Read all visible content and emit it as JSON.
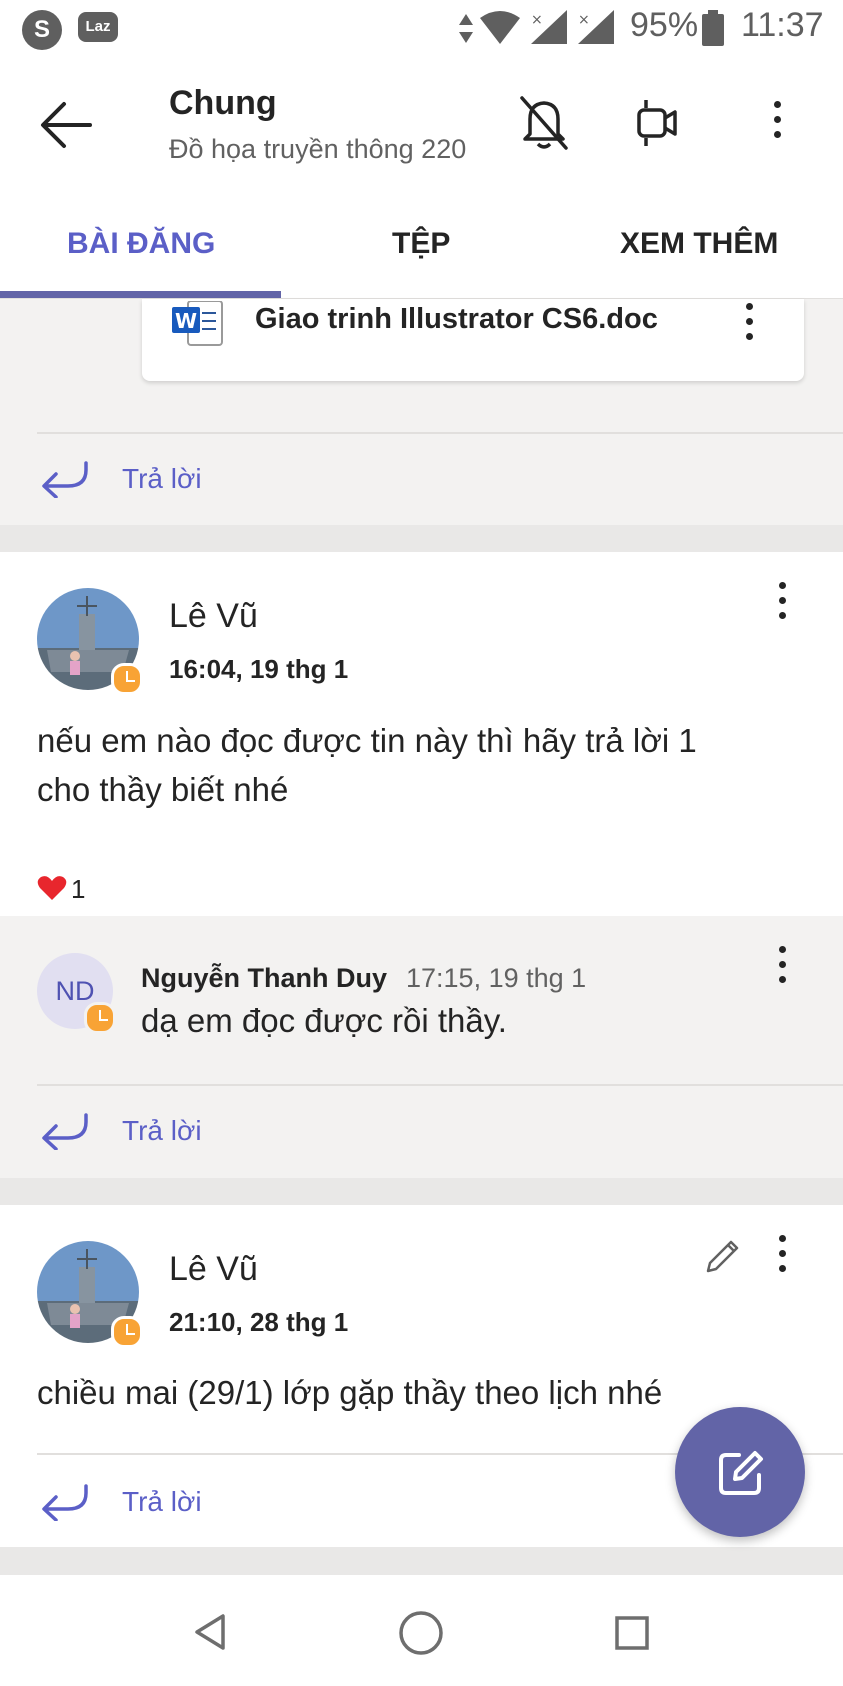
{
  "status_bar": {
    "left_icons": [
      "s-app-icon",
      "lazada-icon"
    ],
    "s_letter": "S",
    "laz_label": "Laz",
    "battery": "95%",
    "time": "11:37"
  },
  "header": {
    "title": "Chung",
    "subtitle": "Đồ họa truyền thông 220"
  },
  "tabs": [
    {
      "label": "BÀI ĐĂNG",
      "active": true
    },
    {
      "label": "TỆP",
      "active": false
    },
    {
      "label": "XEM THÊM",
      "active": false
    }
  ],
  "colors": {
    "accent": "#6264a7",
    "accent_text": "#5b5fc7",
    "presence": "#f8a335",
    "heart": "#e8262d"
  },
  "attachment": {
    "file_name": "Giao trinh Illustrator CS6.doc"
  },
  "reply_label": "Trả lời",
  "posts": [
    {
      "author": "Lê Vũ",
      "time": "16:04, 19 thg 1",
      "message_line1": "nếu em nào đọc được tin này thì hãy trả lời 1",
      "message_line2": "cho thầy biết nhé",
      "reaction_count": "1",
      "reply": {
        "initials": "ND",
        "author": "Nguyễn Thanh Duy",
        "time": "17:15, 19 thg 1",
        "message": "dạ em đọc được rồi thầy."
      }
    },
    {
      "author": "Lê Vũ",
      "time": "21:10, 28 thg 1",
      "message": "chiều mai (29/1) lớp gặp thầy theo lịch nhé"
    }
  ]
}
